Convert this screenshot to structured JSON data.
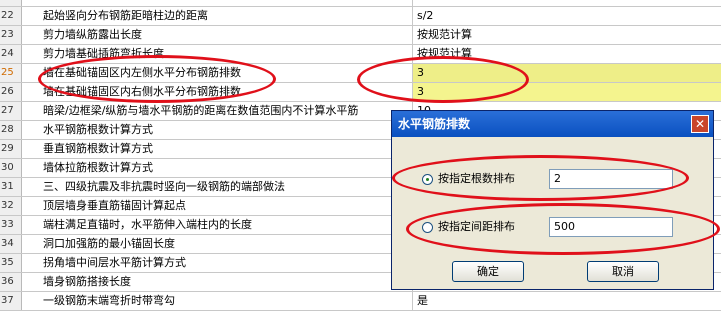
{
  "rows": [
    {
      "num": "",
      "name": "",
      "value": ""
    },
    {
      "num": "22",
      "name": "起始竖向分布钢筋距暗柱边的距离",
      "value": "s/2"
    },
    {
      "num": "23",
      "name": "剪力墙纵筋露出长度",
      "value": "按规范计算"
    },
    {
      "num": "24",
      "name": "剪力墙基础插筋弯折长度",
      "value": "按规范计算"
    },
    {
      "num": "25",
      "name": "墙在基础锚固区内左侧水平分布钢筋排数",
      "value": "3"
    },
    {
      "num": "26",
      "name": "墙在基础锚固区内右侧水平分布钢筋排数",
      "value": "3"
    },
    {
      "num": "27",
      "name": "暗梁/边框梁/纵筋与墙水平钢筋的距离在数值范围内不计算水平筋",
      "value": "10"
    },
    {
      "num": "28",
      "name": "水平钢筋根数计算方式",
      "value": ""
    },
    {
      "num": "29",
      "name": "垂直钢筋根数计算方式",
      "value": ""
    },
    {
      "num": "30",
      "name": "墙体拉筋根数计算方式",
      "value": ""
    },
    {
      "num": "31",
      "name": "三、四级抗震及非抗震时竖向一级钢筋的端部做法",
      "value": ""
    },
    {
      "num": "32",
      "name": "顶层墙身垂直筋锚固计算起点",
      "value": ""
    },
    {
      "num": "33",
      "name": "端柱满足直锚时，水平筋伸入端柱内的长度",
      "value": ""
    },
    {
      "num": "34",
      "name": "洞口加强筋的最小锚固长度",
      "value": ""
    },
    {
      "num": "35",
      "name": "拐角墙中间层水平筋计算方式",
      "value": ""
    },
    {
      "num": "36",
      "name": "墙身钢筋搭接长度",
      "value": ""
    },
    {
      "num": "37",
      "name": "一级钢筋末端弯折时带弯勾",
      "value": "是"
    }
  ],
  "dialog": {
    "title": "水平钢筋排数",
    "close_glyph": "✕",
    "option1_label": "按指定根数排布",
    "option1_value": "2",
    "option2_label": "按指定间距排布",
    "option2_value": "500",
    "ok_label": "确定",
    "cancel_label": "取消"
  }
}
